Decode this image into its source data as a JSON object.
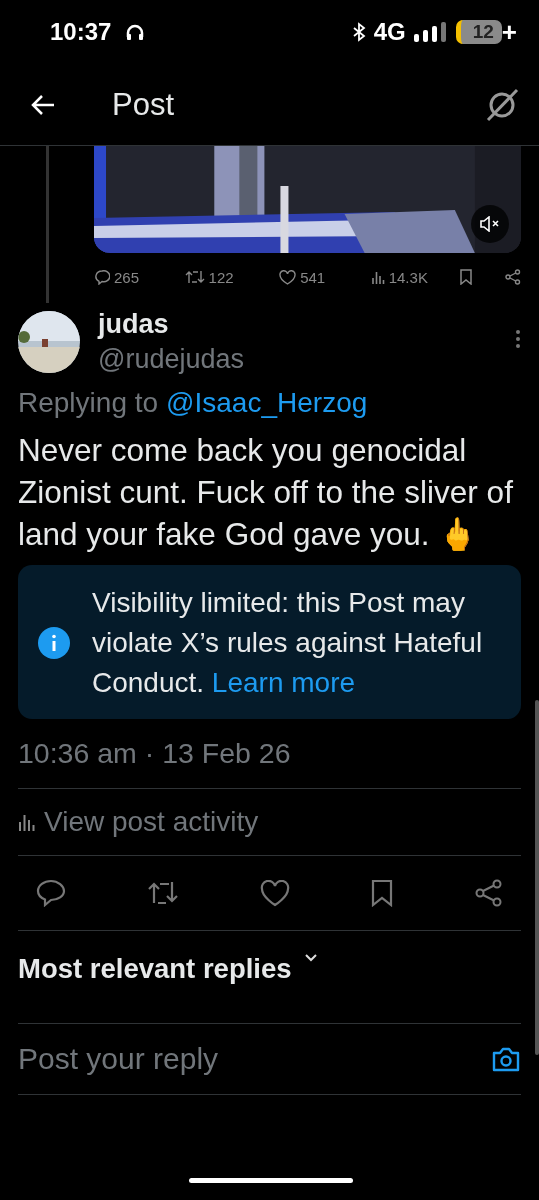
{
  "status_bar": {
    "time": "10:37",
    "network": "4G",
    "battery": "12",
    "charging": "+"
  },
  "header": {
    "title": "Post"
  },
  "parent_post": {
    "media": {
      "kind": "picture",
      "muted": true
    },
    "stats": [
      {
        "kind": "replies",
        "count": "265"
      },
      {
        "kind": "reposts",
        "count": "122"
      },
      {
        "kind": "likes",
        "count": "541"
      },
      {
        "kind": "views",
        "count": "14.3K"
      },
      {
        "kind": "bookmark"
      },
      {
        "kind": "share"
      }
    ]
  },
  "post": {
    "author": {
      "name": "judas",
      "handle": "@rudejudas"
    },
    "replying_to": {
      "label": "Replying to",
      "handle": "@Isaac_Herzog"
    },
    "text": "Never come back you genocidal Zionist cunt. Fuck off to the sliver of land your fake God gave you. 🖕",
    "notice": {
      "text": "Visibility limited: this Post may violate X’s rules against Hateful Conduct.",
      "link": "Learn more"
    },
    "timestamp": "10:36 am · 13 Feb 26",
    "activity": "View post activity",
    "actions": [
      {
        "kind": "reply"
      },
      {
        "kind": "repost"
      },
      {
        "kind": "like"
      },
      {
        "kind": "bookmark"
      },
      {
        "kind": "share"
      }
    ]
  },
  "replies_sort": {
    "label": "Most relevant replies"
  },
  "composer": {
    "placeholder": "Post your reply"
  }
}
